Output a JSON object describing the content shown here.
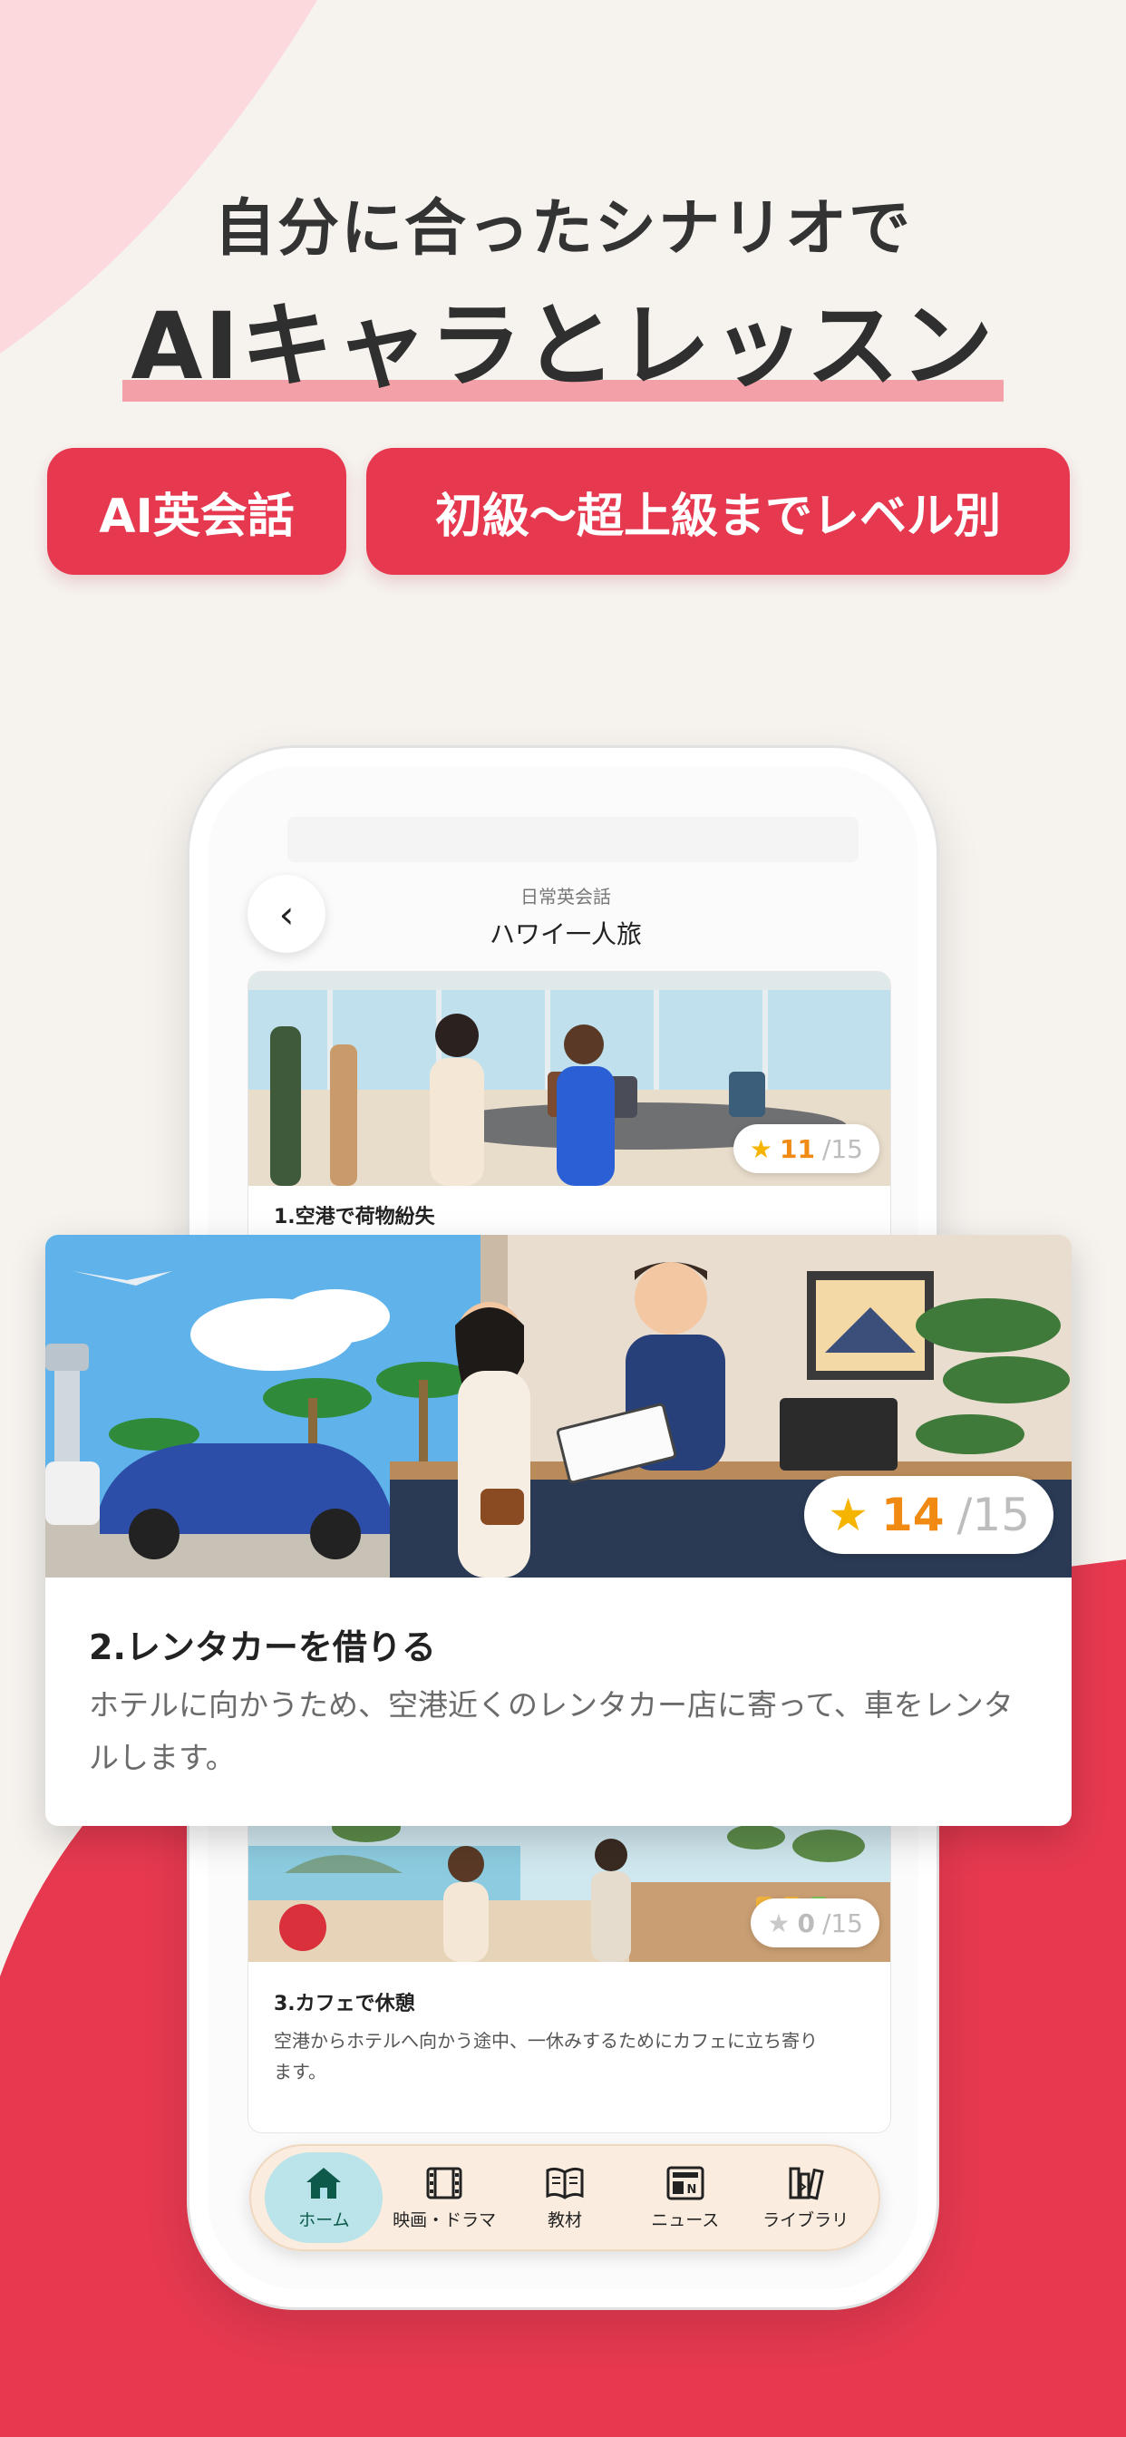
{
  "colors": {
    "accent": "#e63950",
    "highlight": "#f3a0a8",
    "score_star": "#f5b400",
    "score_on": "#f08a12"
  },
  "hero": {
    "line1": "自分に合ったシナリオで",
    "line2": "AIキャラとレッスン",
    "pills": [
      "AI英会話",
      "初級〜超上級までレベル別"
    ]
  },
  "app": {
    "nav": {
      "subtitle": "日常英会話",
      "title": "ハワイ一人旅",
      "back_icon": "chevron-left-icon"
    },
    "lessons": [
      {
        "title": "1.空港で荷物紛失",
        "score": "11",
        "total": "/15",
        "starred": true
      },
      {
        "title": "2.レンタカーを借りる",
        "score": "14",
        "total": "/15",
        "starred": true,
        "description": "ホテルに向かうため、空港近くのレンタカー店に寄って、車をレンタルします。"
      },
      {
        "title": "3.カフェで休憩",
        "score": "0",
        "total": "/15",
        "starred": false,
        "description": "空港からホテルへ向かう途中、一休みするためにカフェに立ち寄ります。"
      }
    ],
    "tabs": [
      {
        "label": "ホーム",
        "icon": "home-icon"
      },
      {
        "label": "映画・ドラマ",
        "icon": "film-icon"
      },
      {
        "label": "教材",
        "icon": "book-icon"
      },
      {
        "label": "ニュース",
        "icon": "news-icon"
      },
      {
        "label": "ライブラリ",
        "icon": "library-icon"
      }
    ]
  }
}
